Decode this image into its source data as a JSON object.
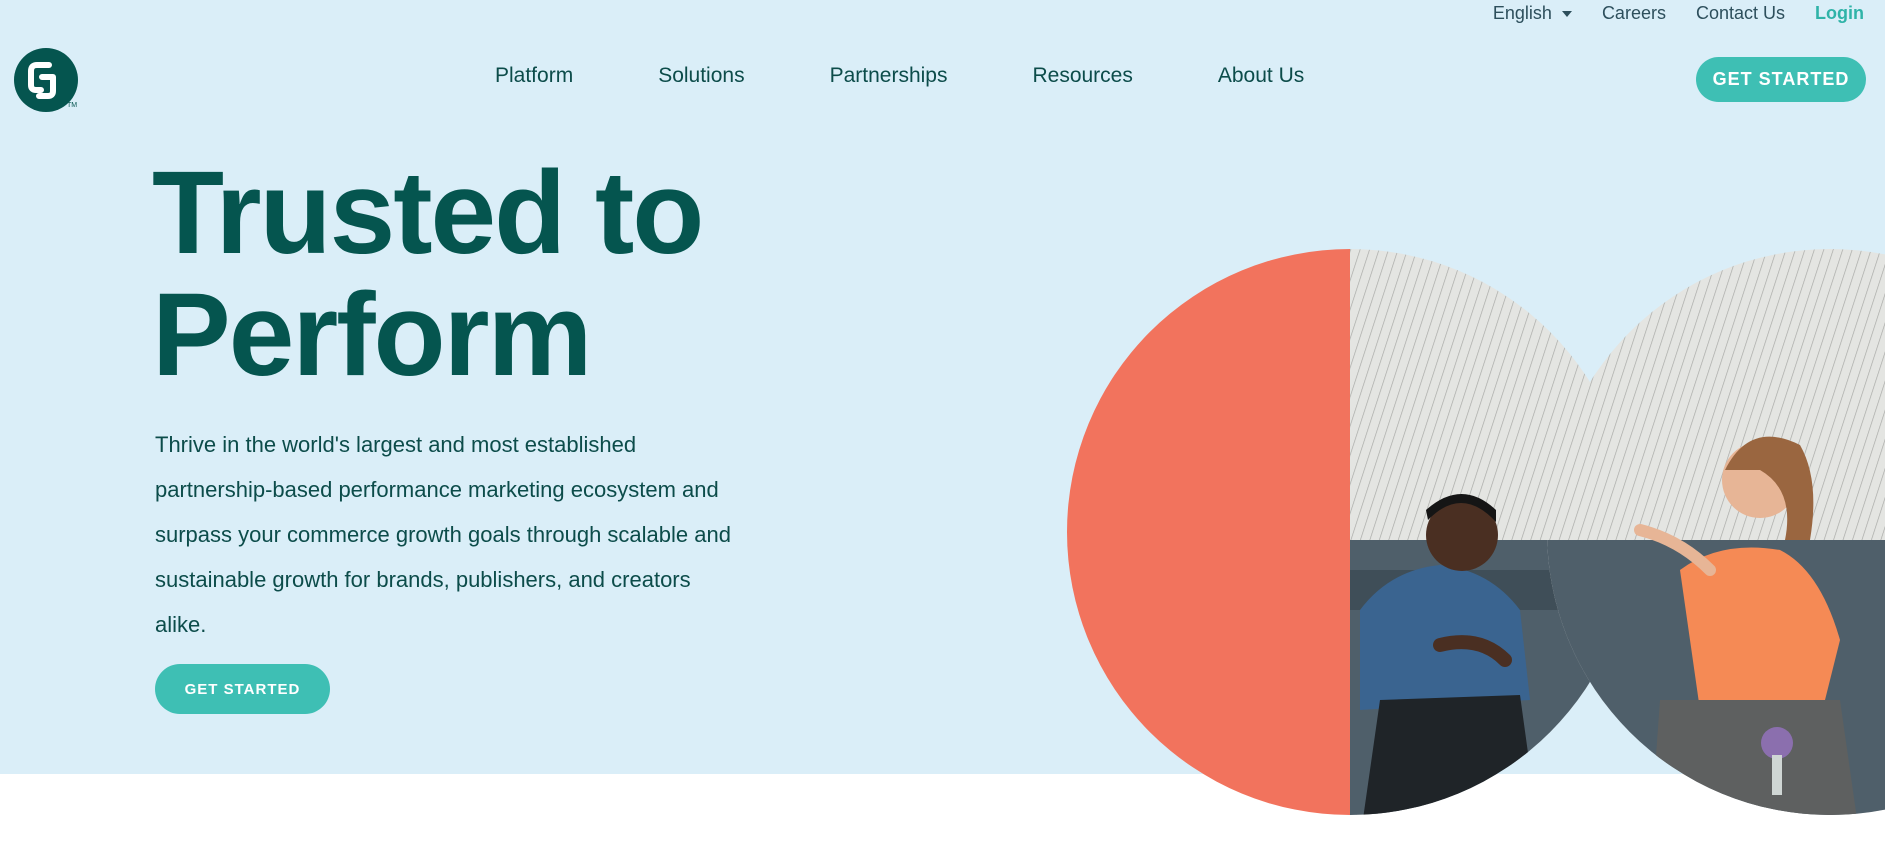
{
  "topbar": {
    "language": "English",
    "careers": "Careers",
    "contact": "Contact Us",
    "login": "Login"
  },
  "logo": {
    "icon": "cj-logo-icon",
    "tm": "TM"
  },
  "nav": {
    "items": [
      {
        "label": "Platform"
      },
      {
        "label": "Solutions"
      },
      {
        "label": "Partnerships"
      },
      {
        "label": "Resources"
      },
      {
        "label": "About Us"
      }
    ],
    "cta": "GET STARTED"
  },
  "hero": {
    "title_line1": "Trusted to",
    "title_line2": "Perform",
    "description": "Thrive in the world's largest and most established partnership-based performance marketing ecosystem and surpass your commerce growth goals through scalable and sustainable growth for brands, publishers, and creators alike.",
    "cta": "GET STARTED"
  },
  "colors": {
    "hero_bg": "#daeef8",
    "brand_dark": "#05554f",
    "accent_teal": "#3ebfb4",
    "coral": "#f2735d"
  }
}
